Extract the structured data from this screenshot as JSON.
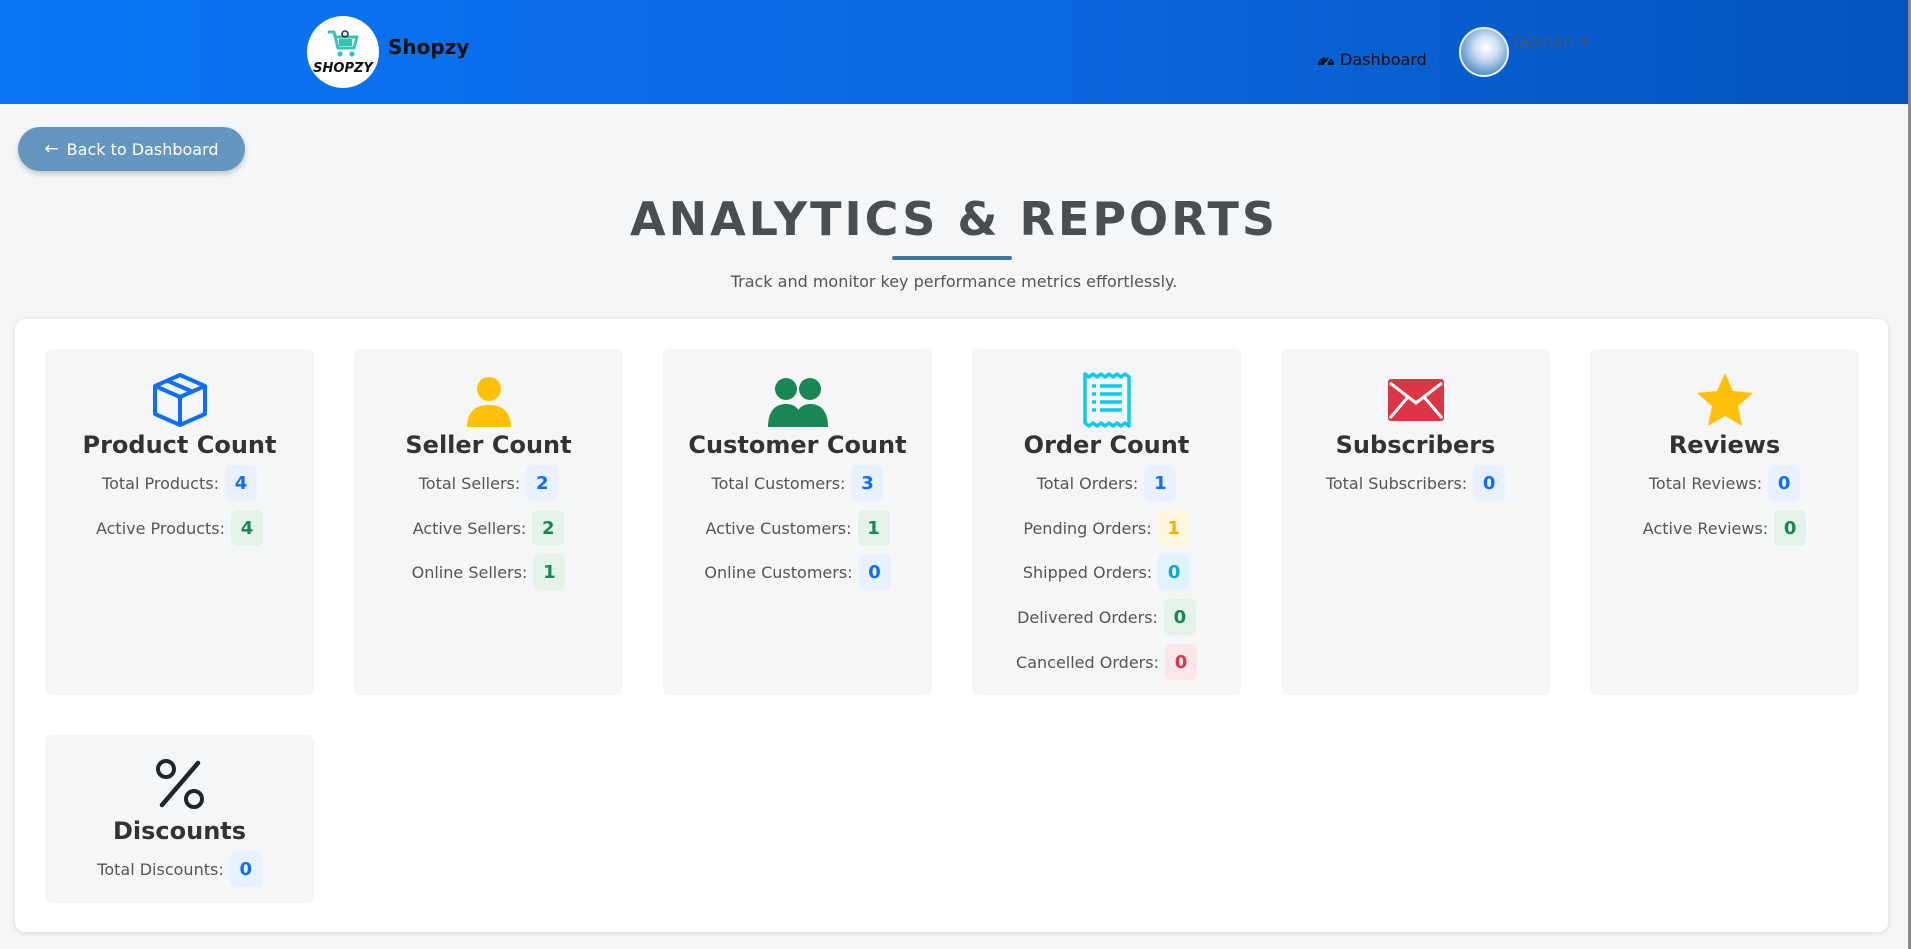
{
  "navbar": {
    "logo_text": "SHOPZY",
    "brand_name": "Shopzy",
    "dashboard_link": "Dashboard",
    "user_name": "Deshan",
    "background_gradient": [
      "#0a75f6",
      "#0553bf"
    ]
  },
  "back_button": {
    "label": "Back to Dashboard",
    "color": "#6496c0"
  },
  "header": {
    "title": "ANALYTICS & REPORTS",
    "subtitle": "Track and monitor key performance metrics effortlessly.",
    "underline_color": "#3e74a8"
  },
  "cards": [
    {
      "title": "Product Count",
      "icon": "box-icon",
      "icon_color": "#0d6efd",
      "stats": [
        {
          "label": "Total Products:",
          "value": "4",
          "color": "blue"
        },
        {
          "label": "Active Products:",
          "value": "4",
          "color": "green"
        }
      ]
    },
    {
      "title": "Seller Count",
      "icon": "person-icon",
      "icon_color": "#ffc107",
      "stats": [
        {
          "label": "Total Sellers:",
          "value": "2",
          "color": "blue"
        },
        {
          "label": "Active Sellers:",
          "value": "2",
          "color": "green"
        },
        {
          "label": "Online Sellers:",
          "value": "1",
          "color": "green"
        }
      ]
    },
    {
      "title": "Customer Count",
      "icon": "people-icon",
      "icon_color": "#198754",
      "stats": [
        {
          "label": "Total Customers:",
          "value": "3",
          "color": "blue"
        },
        {
          "label": "Active Customers:",
          "value": "1",
          "color": "green"
        },
        {
          "label": "Online Customers:",
          "value": "0",
          "color": "blue"
        }
      ]
    },
    {
      "title": "Order Count",
      "icon": "receipt-icon",
      "icon_color": "#0dcaf0",
      "stats": [
        {
          "label": "Total Orders:",
          "value": "1",
          "color": "blue"
        },
        {
          "label": "Pending Orders:",
          "value": "1",
          "color": "yellow"
        },
        {
          "label": "Shipped Orders:",
          "value": "0",
          "color": "cyan"
        },
        {
          "label": "Delivered Orders:",
          "value": "0",
          "color": "green"
        },
        {
          "label": "Cancelled Orders:",
          "value": "0",
          "color": "red"
        }
      ]
    },
    {
      "title": "Subscribers",
      "icon": "envelope-icon",
      "icon_color": "#dc3545",
      "stats": [
        {
          "label": "Total Subscribers:",
          "value": "0",
          "color": "blue"
        }
      ]
    },
    {
      "title": "Reviews",
      "icon": "star-icon",
      "icon_color": "#ffc107",
      "stats": [
        {
          "label": "Total Reviews:",
          "value": "0",
          "color": "blue"
        },
        {
          "label": "Active Reviews:",
          "value": "0",
          "color": "green"
        }
      ]
    },
    {
      "title": "Discounts",
      "icon": "percent-icon",
      "icon_color": "#212529",
      "stats": [
        {
          "label": "Total Discounts:",
          "value": "0",
          "color": "blue"
        }
      ]
    }
  ]
}
